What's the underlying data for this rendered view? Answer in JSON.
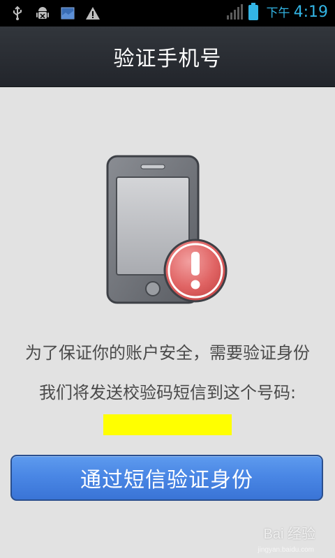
{
  "status_bar": {
    "ampm": "下午",
    "time": "4:19",
    "icons": [
      "usb-icon",
      "android-debug-icon",
      "gallery-icon",
      "warning-icon",
      "signal-icon",
      "battery-icon"
    ],
    "accent_color": "#33b5e5"
  },
  "header": {
    "title": "验证手机号"
  },
  "main": {
    "illustration": "phone-warning-icon",
    "message_line1": "为了保证你的账户安全，需要验证身份",
    "message_line2": "我们将发送校验码短信到这个号码:",
    "phone_number_redaction_color": "#ffff00",
    "verify_button_label": "通过短信验证身份",
    "button_color": "#4a87e5"
  },
  "watermark": {
    "text": "Bai 经验",
    "sub": "jingyan.baidu.com"
  }
}
